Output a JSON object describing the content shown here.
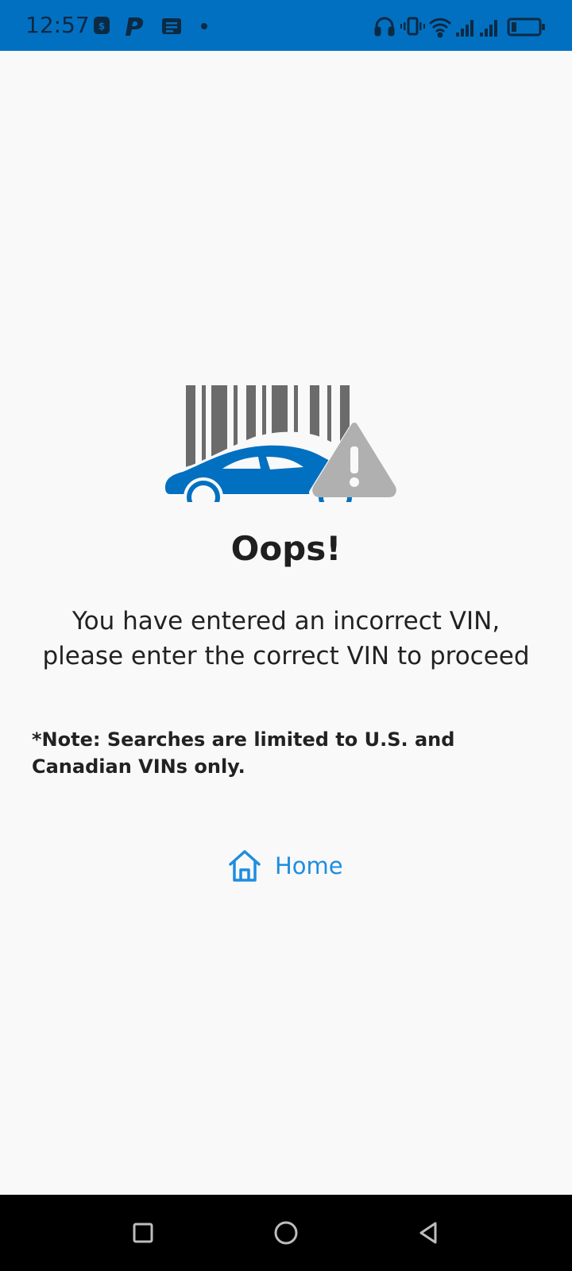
{
  "status_bar": {
    "time": "12:57",
    "bg_color": "#0270c1",
    "left_icons": [
      "shield-app-icon",
      "paypal-icon",
      "message-icon",
      "notification-dot-icon"
    ],
    "right_icons": [
      "headphones-icon",
      "vibrate-icon",
      "wifi-icon",
      "signal-icon",
      "signal-icon",
      "battery-icon"
    ]
  },
  "illustration": {
    "icons": [
      "barcode-icon",
      "car-icon",
      "warning-icon"
    ],
    "car_color": "#0270c1",
    "barcode_color": "#6b6b6b",
    "warning_color": "#b0b0b0"
  },
  "error": {
    "title": "Oops!",
    "message": "You have entered an incorrect VIN, please enter the correct VIN to proceed",
    "note": "*Note: Searches are limited to U.S. and Canadian VINs only."
  },
  "home_link": {
    "label": "Home",
    "icon": "home-icon",
    "color": "#1e8de0"
  },
  "nav_bar": {
    "buttons": [
      "recents-icon",
      "home-circle-icon",
      "back-icon"
    ]
  }
}
